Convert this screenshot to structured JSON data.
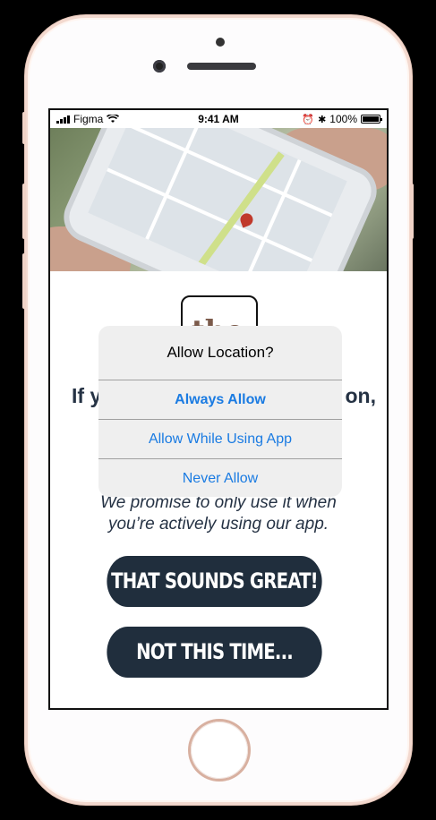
{
  "status_bar": {
    "carrier": "Figma",
    "time": "9:41 AM",
    "battery": "100%"
  },
  "logo_text": "the",
  "headline": {
    "left": "If y",
    "right": "on,"
  },
  "promise_text": [
    "We promise to only use it when",
    "you’re actively using our app."
  ],
  "buttons": {
    "primary": "THAT SOUNDS GREAT!",
    "secondary": "NOT THIS TIME..."
  },
  "dialog": {
    "title": "Allow Location?",
    "options": [
      "Always Allow",
      "Allow While Using App",
      "Never Allow"
    ]
  },
  "colors": {
    "accent": "#1a7be2",
    "button_bg": "#202e3d",
    "text_dark": "#253244"
  }
}
